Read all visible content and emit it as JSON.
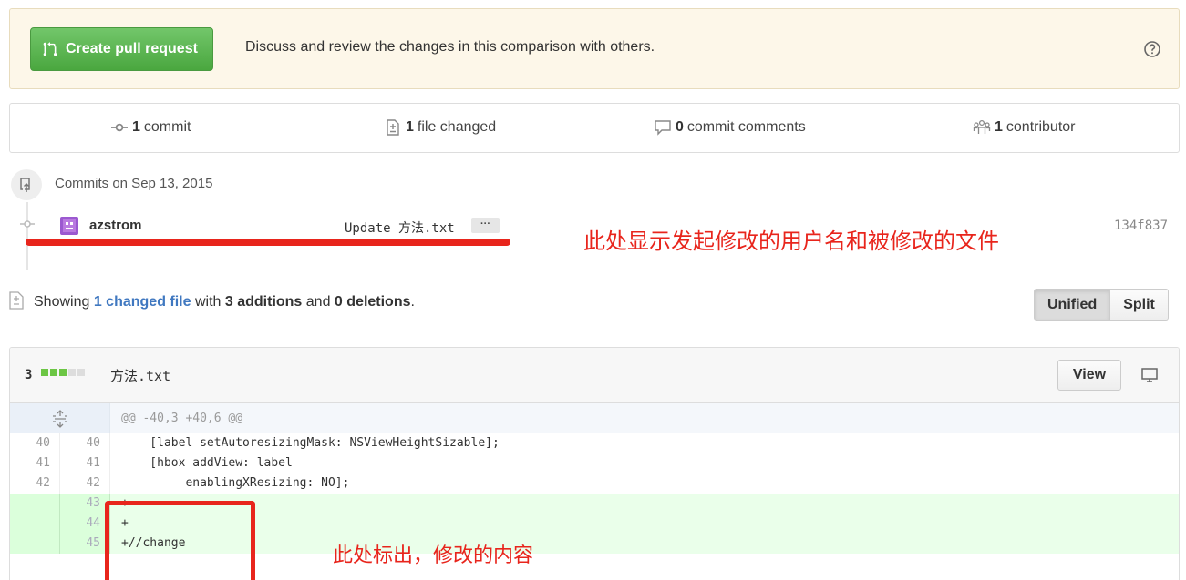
{
  "banner": {
    "button_label": "Create pull request",
    "text": "Discuss and review the changes in this comparison with others.",
    "help_icon": "question-circle-icon"
  },
  "stats": {
    "commits": {
      "count": "1",
      "label": "commit"
    },
    "files": {
      "count": "1",
      "label": "file changed"
    },
    "comments": {
      "count": "0",
      "label": "commit comments"
    },
    "contributors": {
      "count": "1",
      "label": "contributor"
    }
  },
  "commits": {
    "date_heading": "Commits on Sep 13, 2015",
    "items": [
      {
        "author": "azstrom",
        "message": "Update 方法.txt",
        "ellipsis": "···",
        "sha": "134f837"
      }
    ]
  },
  "summary": {
    "prefix": "Showing ",
    "changed_link": "1 changed file",
    "mid1": " with ",
    "additions": "3 additions",
    "mid2": " and ",
    "deletions": "0 deletions",
    "suffix": ".",
    "view_unified": "Unified",
    "view_split": "Split"
  },
  "file": {
    "change_count": "3",
    "name": "方法.txt",
    "view_label": "View",
    "diffstat": {
      "added_blocks": 3,
      "neutral_blocks": 2
    },
    "hunk_header": "@@ -40,3 +40,6 @@",
    "lines": [
      {
        "old": "40",
        "new": "40",
        "type": "context",
        "text": "    [label setAutoresizingMask: NSViewHeightSizable];"
      },
      {
        "old": "41",
        "new": "41",
        "type": "context",
        "text": "    [hbox addView: label"
      },
      {
        "old": "42",
        "new": "42",
        "type": "context",
        "text": "         enablingXResizing: NO];"
      },
      {
        "old": "",
        "new": "43",
        "type": "add",
        "text": "+"
      },
      {
        "old": "",
        "new": "44",
        "type": "add",
        "text": "+"
      },
      {
        "old": "",
        "new": "45",
        "type": "add",
        "text": "+//change"
      }
    ]
  },
  "annotations": {
    "user_and_file": "此处显示发起修改的用户名和被修改的文件",
    "changed_content": "此处标出，修改的内容"
  },
  "colors": {
    "accent_red": "#e8251c",
    "link_blue": "#4078c0",
    "addition_green": "#6cc644"
  }
}
